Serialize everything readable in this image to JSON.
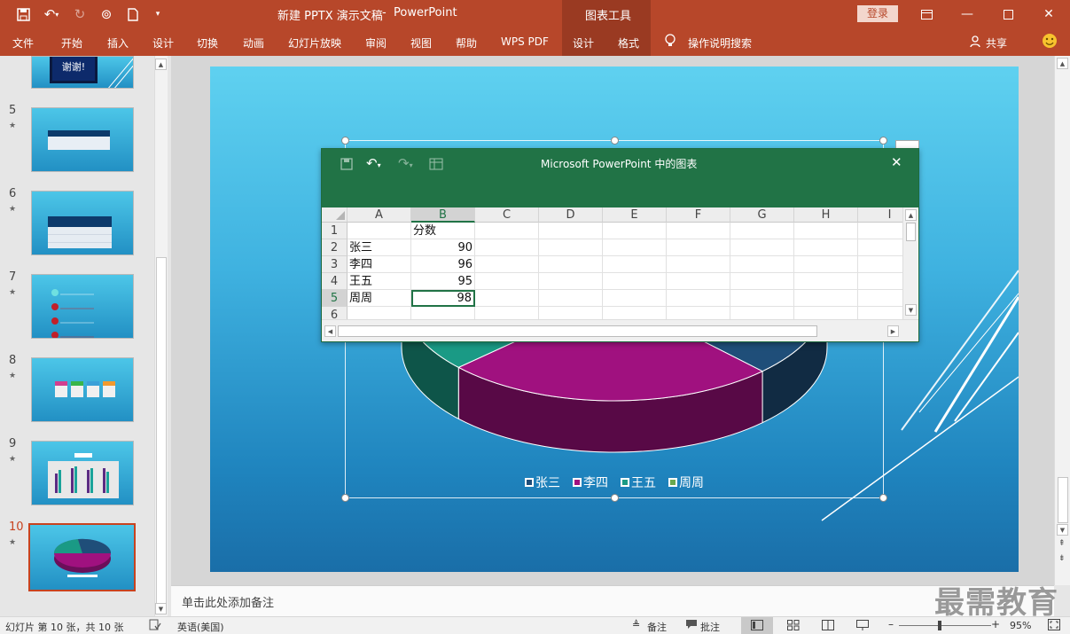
{
  "app": {
    "doc_title": "新建 PPTX 演示文稿",
    "separator": "-",
    "app_name": "PowerPoint",
    "context_tab_group": "图表工具",
    "login_label": "登录"
  },
  "ribbon_tabs": [
    "文件",
    "开始",
    "插入",
    "设计",
    "切换",
    "动画",
    "幻灯片放映",
    "审阅",
    "视图",
    "帮助",
    "WPS PDF",
    "设计",
    "格式"
  ],
  "tell_me": "操作说明搜索",
  "share_label": "共享",
  "slides": [
    {
      "number": "",
      "star": ""
    },
    {
      "number": "5",
      "star": "★"
    },
    {
      "number": "6",
      "star": "★"
    },
    {
      "number": "7",
      "star": "★"
    },
    {
      "number": "8",
      "star": "★"
    },
    {
      "number": "9",
      "star": "★"
    },
    {
      "number": "10",
      "star": "★"
    }
  ],
  "thumb_texts": {
    "slide4": "谢谢!"
  },
  "current_slide": 10,
  "chart_dialog": {
    "title": "Microsoft PowerPoint 中的图表",
    "columns": [
      "A",
      "B",
      "C",
      "D",
      "E",
      "F",
      "G",
      "H",
      "I"
    ],
    "rows": [
      {
        "n": "1",
        "a": "",
        "b": "分数"
      },
      {
        "n": "2",
        "a": "张三",
        "b": "90"
      },
      {
        "n": "3",
        "a": "李四",
        "b": "96"
      },
      {
        "n": "4",
        "a": "王五",
        "b": "95"
      },
      {
        "n": "5",
        "a": "周周",
        "b": "98"
      },
      {
        "n": "6",
        "a": "",
        "b": ""
      }
    ]
  },
  "chart_data": {
    "type": "pie",
    "categories": [
      "张三",
      "李四",
      "王五",
      "周周"
    ],
    "values": [
      90,
      96,
      95,
      98
    ],
    "colors": [
      "#1f4e79",
      "#a0117f",
      "#1a9a85",
      "#6aa84f"
    ]
  },
  "legend": [
    {
      "label": "张三",
      "color": "#1f4e79"
    },
    {
      "label": "李四",
      "color": "#a0117f"
    },
    {
      "label": "王五",
      "color": "#1a9a85"
    },
    {
      "label": "周周",
      "color": "#6aa84f"
    }
  ],
  "notes_placeholder": "单击此处添加备注",
  "status": {
    "slide_info": "幻灯片 第 10 张，共 10 张",
    "language": "英语(美国)",
    "notes_btn": "备注",
    "comments_btn": "批注",
    "zoom": "95%"
  },
  "watermark": "最需教育"
}
